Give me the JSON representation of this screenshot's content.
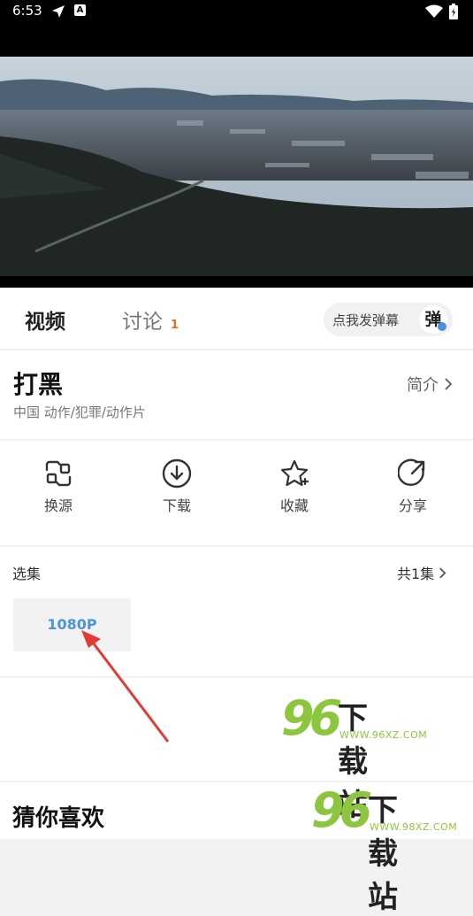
{
  "status_bar": {
    "time": "6:53"
  },
  "tabs": {
    "video": "视频",
    "discussion": "讨论",
    "discussion_count": "1"
  },
  "danmaku": {
    "label": "点我发弹幕",
    "icon_char": "弹"
  },
  "movie": {
    "title": "打黑",
    "meta": "中国 动作/犯罪/动作片",
    "intro_link": "简介"
  },
  "actions": [
    {
      "label": "换源",
      "icon": "switch-source-icon"
    },
    {
      "label": "下载",
      "icon": "download-icon"
    },
    {
      "label": "收藏",
      "icon": "star-icon"
    },
    {
      "label": "分享",
      "icon": "share-icon"
    }
  ],
  "episodes": {
    "header": "选集",
    "count": "共1集",
    "items": [
      "1080P"
    ]
  },
  "recommend": {
    "title": "猜你喜欢"
  },
  "watermarks": [
    {
      "number": "96",
      "text": "下载站",
      "url": "WWW.96XZ.COM"
    },
    {
      "number": "96",
      "text": "下载站",
      "url": "WWW.98XZ.COM"
    }
  ],
  "colors": {
    "accent": "#4b95d4",
    "badge": "#f26b1d",
    "annotation_arrow": "#e53935"
  }
}
